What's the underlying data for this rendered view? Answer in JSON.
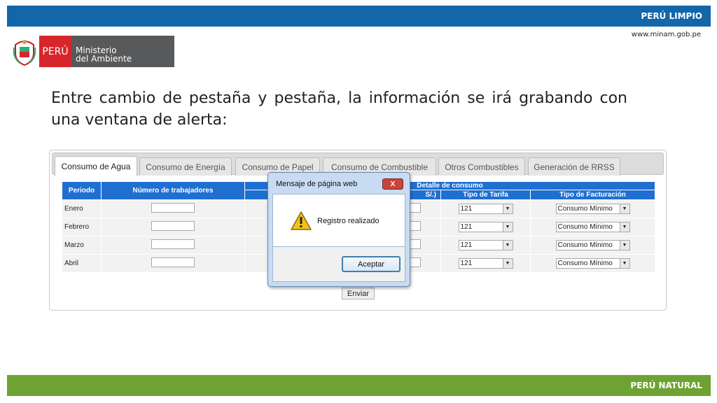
{
  "header": {
    "brand_top": "PERÚ LIMPIO",
    "url": "www.minam.gob.pe"
  },
  "logo": {
    "peru": "PERÚ",
    "line1": "Ministerio",
    "line2": "del Ambiente"
  },
  "heading": "Entre cambio de pestaña y pestaña, la información se irá grabando con una ventana de alerta:",
  "tabs": [
    {
      "label": "Consumo de Agua"
    },
    {
      "label": "Consumo de Energía"
    },
    {
      "label": "Consumo de Papel"
    },
    {
      "label": "Consumo de Combustible"
    },
    {
      "label": "Otros Combustibles"
    },
    {
      "label": "Generación de RRSS"
    }
  ],
  "table": {
    "col_periodo": "Periodo",
    "col_trabajadores": "Número de trabajadores",
    "col_detalle": "Detalle de consumo",
    "col_partial": "S/.)",
    "col_tarifa": "Tipo de Tarifa",
    "col_facturacion": "Tipo de Facturación",
    "rows": [
      {
        "periodo": "Enero",
        "tarifa": "121",
        "facturacion": "Consumo Mínimo"
      },
      {
        "periodo": "Febrero",
        "tarifa": "121",
        "facturacion": "Consumo Mínimo"
      },
      {
        "periodo": "Marzo",
        "tarifa": "121",
        "facturacion": "Consumo Mínimo"
      },
      {
        "periodo": "Abril",
        "tarifa": "121",
        "facturacion": "Consumo Mínimo"
      }
    ],
    "submit": "Enviar"
  },
  "dialog": {
    "title": "Mensaje de página web",
    "close": "X",
    "message": "Registro realizado",
    "button": "Aceptar"
  },
  "footer": {
    "brand_bottom": "PERÚ NATURAL"
  },
  "colors": {
    "top_bar": "#1366a8",
    "bottom_bar": "#6ea232",
    "table_header": "#1f6fd1",
    "logo_red": "#d7262b",
    "logo_gray": "#58595b"
  },
  "icons": [
    "coat-of-arms-icon",
    "warning-icon",
    "chevron-down-icon"
  ]
}
